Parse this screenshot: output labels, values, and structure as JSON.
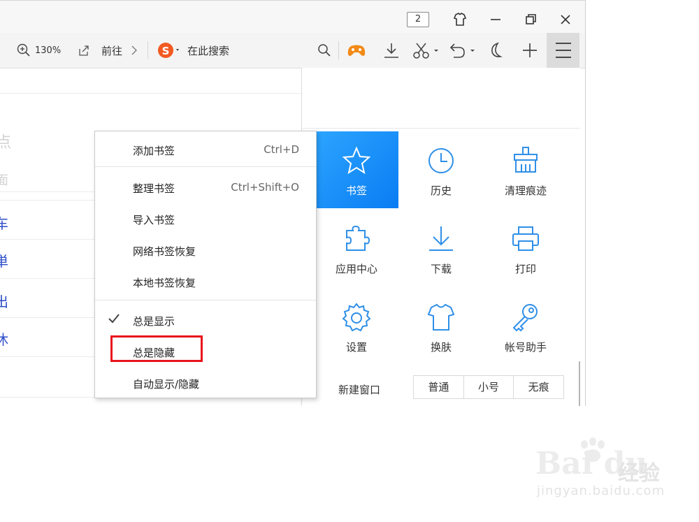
{
  "titlebar": {
    "tab_count": "2"
  },
  "toolbar": {
    "zoom": "130%",
    "goto_label": "前往",
    "search_placeholder": "在此搜索"
  },
  "page_left": {
    "links": [
      "车",
      "単",
      "出",
      "休"
    ],
    "ghost": [
      "点",
      "面"
    ]
  },
  "menu": {
    "items": [
      {
        "label": "添加书签",
        "shortcut": "Ctrl+D"
      },
      {
        "label": "整理书签",
        "shortcut": "Ctrl+Shift+O"
      },
      {
        "label": "导入书签",
        "shortcut": ""
      },
      {
        "label": "网络书签恢复",
        "shortcut": ""
      },
      {
        "label": "本地书签恢复",
        "shortcut": ""
      },
      {
        "label": "总是显示",
        "shortcut": ""
      },
      {
        "label": "总是隐藏",
        "shortcut": ""
      },
      {
        "label": "自动显示/隐藏",
        "shortcut": ""
      }
    ]
  },
  "panel": {
    "grid": [
      {
        "label": "书签",
        "icon": "star-icon"
      },
      {
        "label": "历史",
        "icon": "clock-icon"
      },
      {
        "label": "清理痕迹",
        "icon": "broom-icon"
      },
      {
        "label": "应用中心",
        "icon": "puzzle-icon"
      },
      {
        "label": "下载",
        "icon": "download-icon"
      },
      {
        "label": "打印",
        "icon": "printer-icon"
      },
      {
        "label": "设置",
        "icon": "gear-icon"
      },
      {
        "label": "换肤",
        "icon": "tshirt-icon"
      },
      {
        "label": "帐号助手",
        "icon": "key-icon"
      }
    ],
    "new_window_label": "新建窗口",
    "new_window_options": [
      "普通",
      "小号",
      "无痕"
    ]
  },
  "watermark": {
    "brand": "Bai du",
    "cn": "经验",
    "url": "jingyan.baidu.com"
  },
  "colors": {
    "accent_blue": "#1a8cff",
    "icon_blue": "#2f8fe8",
    "highlight_red": "#e8141c"
  }
}
